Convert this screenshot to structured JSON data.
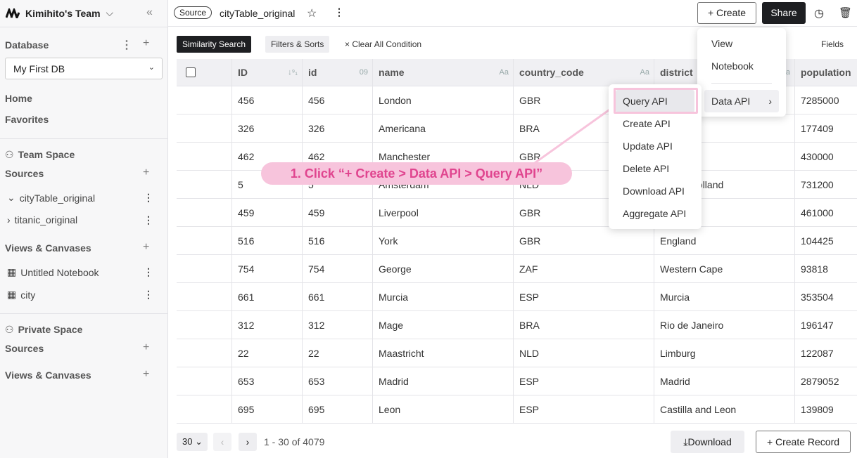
{
  "sidebar": {
    "team": "Kimihito's Team",
    "database_label": "Database",
    "db_selected": "My First DB",
    "home": "Home",
    "favorites": "Favorites",
    "team_space": "Team Space",
    "sources": "Sources",
    "team_sources": [
      {
        "label": "cityTable_original",
        "expanded": true
      },
      {
        "label": "titanic_original",
        "expanded": false
      }
    ],
    "views_canvases": "Views & Canvases",
    "team_views": [
      {
        "label": "Untitled Notebook"
      },
      {
        "label": "city"
      }
    ],
    "private_space": "Private Space",
    "private_sources": "Sources",
    "private_views": "Views & Canvases"
  },
  "topbar": {
    "source_badge": "Source",
    "table_name": "cityTable_original",
    "create": "+ Create",
    "share": "Share"
  },
  "toolbar": {
    "similarity": "Similarity Search",
    "filters": "Filters & Sorts",
    "clear": "× Clear All Condition",
    "fields": "Fields"
  },
  "table": {
    "headers": [
      {
        "label": "ID",
        "icon": "↓⁹₁"
      },
      {
        "label": "id",
        "icon": "09"
      },
      {
        "label": "name",
        "icon": "Aa"
      },
      {
        "label": "country_code",
        "icon": "Aa"
      },
      {
        "label": "district",
        "icon": "Aa"
      },
      {
        "label": "population",
        "icon": ""
      }
    ],
    "rows": [
      [
        "456",
        "456",
        "London",
        "GBR",
        "",
        "7285000"
      ],
      [
        "326",
        "326",
        "Americana",
        "BRA",
        "",
        "177409"
      ],
      [
        "462",
        "462",
        "Manchester",
        "GBR",
        "",
        "430000"
      ],
      [
        "5",
        "5",
        "Amsterdam",
        "NLD",
        "Noord-Holland",
        "731200"
      ],
      [
        "459",
        "459",
        "Liverpool",
        "GBR",
        "",
        "461000"
      ],
      [
        "516",
        "516",
        "York",
        "GBR",
        "England",
        "104425"
      ],
      [
        "754",
        "754",
        "George",
        "ZAF",
        "Western Cape",
        "93818"
      ],
      [
        "661",
        "661",
        "Murcia",
        "ESP",
        "Murcia",
        "353504"
      ],
      [
        "312",
        "312",
        "Mage",
        "BRA",
        "Rio de Janeiro",
        "196147"
      ],
      [
        "22",
        "22",
        "Maastricht",
        "NLD",
        "Limburg",
        "122087"
      ],
      [
        "653",
        "653",
        "Madrid",
        "ESP",
        "Madrid",
        "2879052"
      ],
      [
        "695",
        "695",
        "Leon",
        "ESP",
        "Castilla and Leon",
        "139809"
      ]
    ]
  },
  "footer": {
    "page_size": "30",
    "range": "1 - 30 of 4079",
    "download": "Download",
    "create_record": "+ Create Record"
  },
  "create_menu": {
    "items": [
      "View",
      "Notebook",
      "Data API"
    ]
  },
  "data_api_menu": {
    "items": [
      "Query API",
      "Create API",
      "Update API",
      "Delete API",
      "Download API",
      "Aggregate API"
    ],
    "highlighted": "Query API"
  },
  "annotation": "1. Click “+ Create > Data API > Query API”",
  "colors": {
    "accent_pink": "#f7c4dc",
    "annotation_text": "#e0458f",
    "dark": "#1e1f22"
  }
}
